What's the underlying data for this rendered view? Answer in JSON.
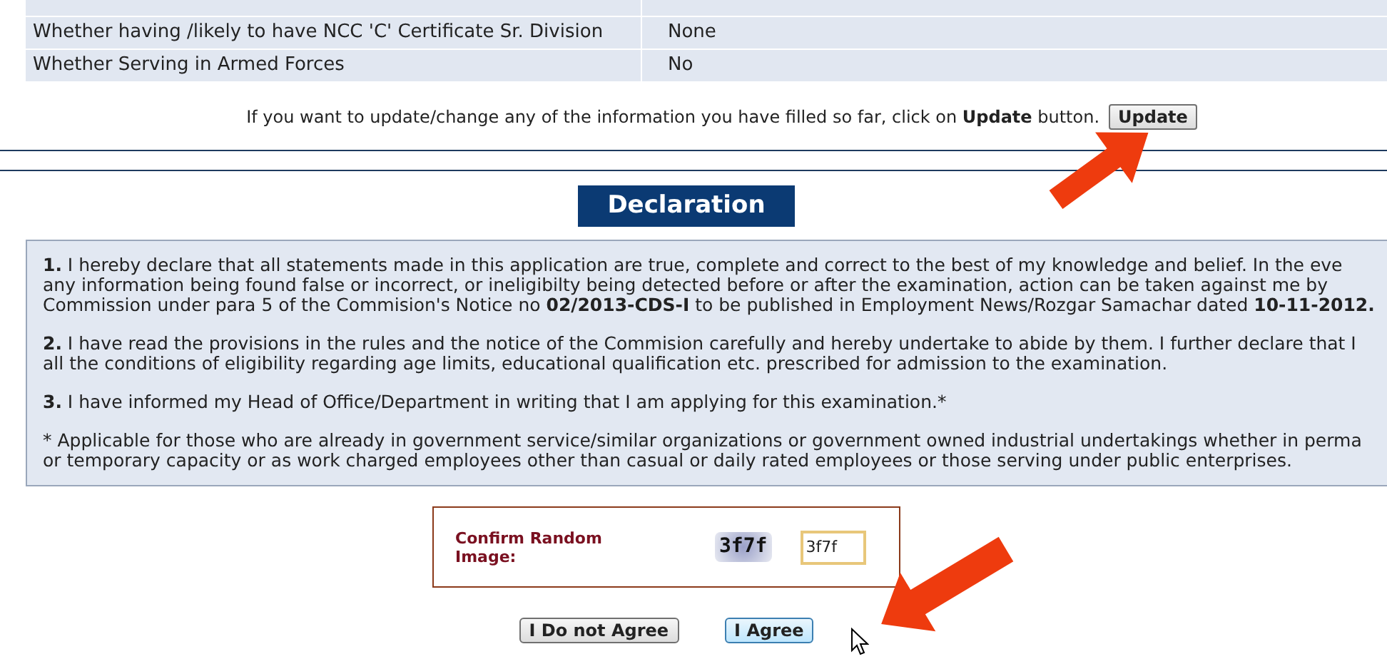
{
  "details_table": {
    "rows": [
      {
        "label": "Whether having /likely to have NCC 'C' Certificate Sr. Division",
        "value": "None"
      },
      {
        "label": "Whether Serving in Armed Forces",
        "value": "No"
      }
    ]
  },
  "update_note": "If you want to update/change any of the information you have filled so far, click on **Update** button.",
  "update_button": "Update",
  "declaration": {
    "title": "Declaration",
    "paragraphs": [
      {
        "lines": [
          "**1.** I hereby declare that all statements made in this application are true, complete and correct to the best of my knowledge and belief. In the eve",
          "any information being found false or incorrect, or ineligibilty being detected before or after the examination, action can be taken against me by",
          "Commission under para 5 of the Commision's Notice no **02/2013-CDS-I** to be published in Employment News/Rozgar Samachar dated **10-11-2012.**"
        ]
      },
      {
        "lines": [
          "**2.** I have read the provisions in the rules and the notice of the Commision carefully and hereby undertake to abide by them. I further declare that I",
          "all the conditions of eligibility regarding age limits, educational qualification etc. prescribed for admission to the examination."
        ]
      },
      {
        "lines": [
          "**3.** I have informed my Head of Office/Department in writing that I am applying for this examination.*"
        ]
      },
      {
        "lines": [
          "* Applicable for those who are already in government service/similar organizations or government owned industrial undertakings whether in perma",
          "or temporary capacity or as work charged employees other than casual or daily rated employees or those serving under public enterprises."
        ]
      }
    ]
  },
  "captcha": {
    "label": "Confirm Random Image:",
    "image_text": "3f7f",
    "value": "3f7f"
  },
  "buttons": [
    {
      "label": "I Do not Agree",
      "hovered": false
    },
    {
      "label": "I Agree",
      "hovered": true
    }
  ]
}
